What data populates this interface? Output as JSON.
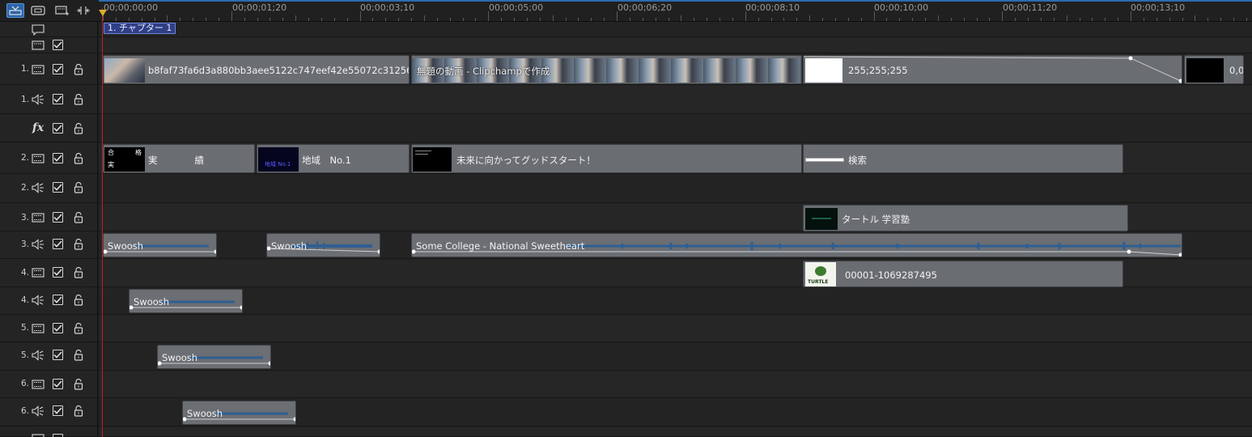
{
  "ruler": {
    "timecodes": [
      "00;00;00;00",
      "00;00;01;20",
      "00;00;03;10",
      "00;00;05;00",
      "00;00;06;20",
      "00;00;08;10",
      "00;00;10;00",
      "00;00;11;20",
      "00;00;13;10"
    ]
  },
  "chapter": {
    "label": "1. チャプター 1"
  },
  "track_numbers": {
    "video1": "1.",
    "audio1": "1.",
    "video2": "2.",
    "audio2": "2.",
    "video3": "3.",
    "audio3": "3.",
    "video4": "4.",
    "audio4": "4.",
    "video5": "5.",
    "audio5": "5.",
    "video6": "6.",
    "audio6": "6."
  },
  "clips": {
    "video1_a": "b8faf73fa6d3a880bb3aee5122c747eef42e55072c31256140acbc…",
    "video1_b": "無題の動画 - Clipchampで作成",
    "video1_c": "255;255;255",
    "video1_d": "0,0,",
    "title_a": "実　　　　績",
    "title_a_thumb": [
      "合",
      "格",
      "実"
    ],
    "title_b": "地域　No.1",
    "title_b_thumb": "地域 No.1",
    "title_c": "未来に向かってグッドスタート！",
    "title_d": "検索",
    "video3_a": "タートル 学習塾",
    "audio3_a": "Swoosh",
    "audio3_b": "Swoosh",
    "audio3_c": "Some College - National Sweetheart",
    "video4_a": "00001-1069287495",
    "video4_thumb": "TURTLE",
    "audio4_a": "Swoosh",
    "audio5_a": "Swoosh",
    "audio6_a": "Swoosh"
  },
  "colors": {
    "accent": "#2b64a8",
    "playhead": "#c0202a",
    "clip": "#6a6d72",
    "waveform": "#2e5f92",
    "chapter": "#2f3f86"
  },
  "icons": {
    "toolbar": [
      "timeline-view-icon",
      "storyboard-view-icon",
      "track-manager-icon",
      "fit-timeline-icon"
    ],
    "track_types": [
      "subtitle-track-icon",
      "video-track-icon",
      "audio-track-icon",
      "fx-track-icon"
    ]
  }
}
